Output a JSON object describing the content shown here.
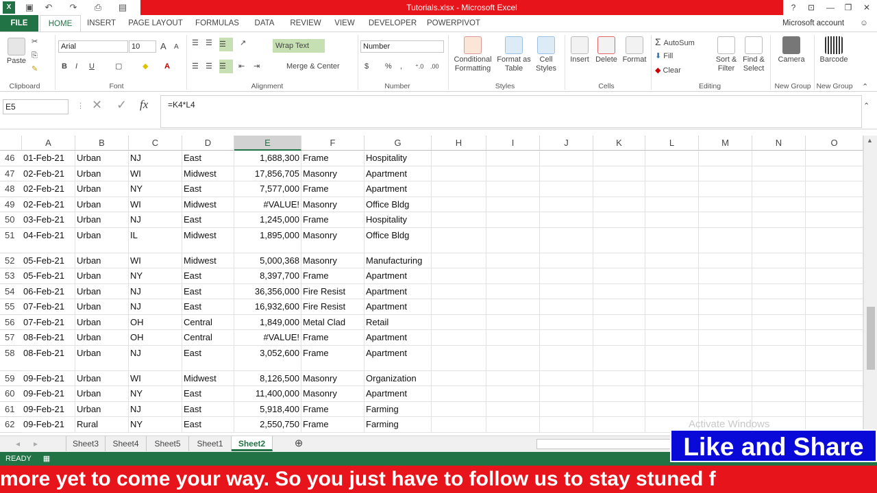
{
  "title_bar": {
    "title": "Tutorials.xlsx - Microsoft Excel",
    "help": "?"
  },
  "tabs": [
    "FILE",
    "HOME",
    "INSERT",
    "PAGE LAYOUT",
    "FORMULAS",
    "DATA",
    "REVIEW",
    "VIEW",
    "DEVELOPER",
    "POWERPIVOT"
  ],
  "account": "Microsoft account",
  "ribbon": {
    "clipboard": {
      "paste": "Paste",
      "label": "Clipboard"
    },
    "font": {
      "name": "Arial",
      "size": "10",
      "bold": "B",
      "italic": "I",
      "underline": "U",
      "label": "Font",
      "grow": "A",
      "shrink": "A"
    },
    "alignment": {
      "wrap": "Wrap Text",
      "merge": "Merge & Center",
      "label": "Alignment"
    },
    "number": {
      "format": "Number",
      "currency": "$",
      "percent": "%",
      "comma": ",",
      "label": "Number"
    },
    "styles": {
      "conditional": "Conditional",
      "conditional2": "Formatting",
      "format_table": "Format as",
      "format_table2": "Table",
      "cell_styles": "Cell",
      "cell_styles2": "Styles",
      "label": "Styles"
    },
    "cells": {
      "insert": "Insert",
      "delete": "Delete",
      "format": "Format",
      "label": "Cells"
    },
    "editing": {
      "autosum": "AutoSum",
      "fill": "Fill",
      "clear": "Clear",
      "sort": "Sort &",
      "sort2": "Filter",
      "find": "Find &",
      "find2": "Select",
      "label": "Editing"
    },
    "camera": {
      "label": "Camera",
      "group": "New Group"
    },
    "barcode": {
      "label": "Barcode",
      "group": "New Group"
    }
  },
  "formula_bar": {
    "name_box": "E5",
    "formula": "=K4*L4",
    "fx": "fx"
  },
  "columns": [
    "A",
    "B",
    "C",
    "D",
    "E",
    "F",
    "G",
    "H",
    "I",
    "J",
    "K",
    "L",
    "M",
    "N",
    "O"
  ],
  "rows": [
    {
      "n": "46",
      "a": "01-Feb-21",
      "b": "Urban",
      "c": "NJ",
      "d": "East",
      "e": "1,688,300",
      "f": "Frame",
      "g": "Hospitality"
    },
    {
      "n": "47",
      "a": "02-Feb-21",
      "b": "Urban",
      "c": "WI",
      "d": "Midwest",
      "e": "17,856,705",
      "f": "Masonry",
      "g": "Apartment"
    },
    {
      "n": "48",
      "a": "02-Feb-21",
      "b": "Urban",
      "c": "NY",
      "d": "East",
      "e": "7,577,000",
      "f": "Frame",
      "g": "Apartment"
    },
    {
      "n": "49",
      "a": "02-Feb-21",
      "b": "Urban",
      "c": "WI",
      "d": "Midwest",
      "e": "#VALUE!",
      "f": "Masonry",
      "g": "Office Bldg"
    },
    {
      "n": "50",
      "a": "03-Feb-21",
      "b": "Urban",
      "c": "NJ",
      "d": "East",
      "e": "1,245,000",
      "f": "Frame",
      "g": "Hospitality"
    },
    {
      "n": "51",
      "a": "04-Feb-21",
      "b": "Urban",
      "c": "IL",
      "d": "Midwest",
      "e": "1,895,000",
      "f": "Masonry",
      "g": "Office Bldg"
    },
    {
      "n": "52",
      "a": "05-Feb-21",
      "b": "Urban",
      "c": "WI",
      "d": "Midwest",
      "e": "5,000,368",
      "f": "Masonry",
      "g": "Manufacturing"
    },
    {
      "n": "53",
      "a": "05-Feb-21",
      "b": "Urban",
      "c": "NY",
      "d": "East",
      "e": "8,397,700",
      "f": "Frame",
      "g": "Apartment"
    },
    {
      "n": "54",
      "a": "06-Feb-21",
      "b": "Urban",
      "c": "NJ",
      "d": "East",
      "e": "36,356,000",
      "f": "Fire Resist",
      "g": "Apartment"
    },
    {
      "n": "55",
      "a": "07-Feb-21",
      "b": "Urban",
      "c": "NJ",
      "d": "East",
      "e": "16,932,600",
      "f": "Fire Resist",
      "g": "Apartment"
    },
    {
      "n": "56",
      "a": "07-Feb-21",
      "b": "Urban",
      "c": "OH",
      "d": "Central",
      "e": "1,849,000",
      "f": "Metal Clad",
      "g": "Retail"
    },
    {
      "n": "57",
      "a": "08-Feb-21",
      "b": "Urban",
      "c": "OH",
      "d": "Central",
      "e": "#VALUE!",
      "f": "Frame",
      "g": "Apartment"
    },
    {
      "n": "58",
      "a": "08-Feb-21",
      "b": "Urban",
      "c": "NJ",
      "d": "East",
      "e": "3,052,600",
      "f": "Frame",
      "g": "Apartment"
    },
    {
      "n": "59",
      "a": "09-Feb-21",
      "b": "Urban",
      "c": "WI",
      "d": "Midwest",
      "e": "8,126,500",
      "f": "Masonry",
      "g": "Organization"
    },
    {
      "n": "60",
      "a": "09-Feb-21",
      "b": "Urban",
      "c": "NY",
      "d": "East",
      "e": "11,400,000",
      "f": "Masonry",
      "g": "Apartment"
    },
    {
      "n": "61",
      "a": "09-Feb-21",
      "b": "Urban",
      "c": "NJ",
      "d": "East",
      "e": "5,918,400",
      "f": "Frame",
      "g": "Farming"
    },
    {
      "n": "62",
      "a": "09-Feb-21",
      "b": "Rural",
      "c": "NY",
      "d": "East",
      "e": "2,550,750",
      "f": "Frame",
      "g": "Farming"
    }
  ],
  "sheets": [
    "Sheet3",
    "Sheet4",
    "Sheet5",
    "Sheet1",
    "Sheet2"
  ],
  "active_sheet": "Sheet2",
  "status": "READY",
  "overlay": {
    "like": "Like and Share",
    "ticker": "more yet to come your way. So you just have to follow us to stay stuned f",
    "watermark": "Activate Windows"
  },
  "colors": {
    "excel_green": "#217346",
    "title_red": "#e8141b",
    "like_blue": "#0a0ad8"
  }
}
